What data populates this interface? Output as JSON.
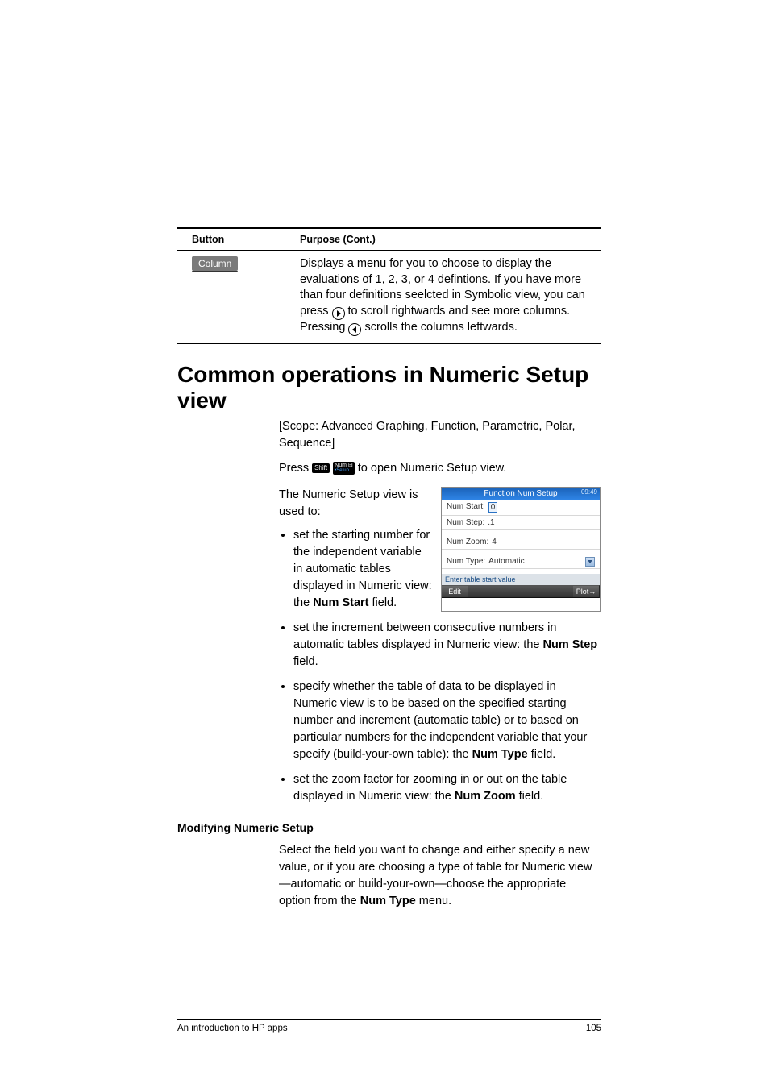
{
  "table": {
    "header_button": "Button",
    "header_purpose": "Purpose  (Cont.)",
    "column_btn": "Column",
    "purpose_l1": "Displays a menu for you to choose to display the evaluations of 1, 2, 3, or 4 defintions. If you have more than four definitions seelcted in Symbolic view, you can press ",
    "purpose_l2": " to scroll rightwards and see more columns. Pressing ",
    "purpose_l3": " scrolls the columns leftwards."
  },
  "section_title": "Common operations in Numeric Setup view",
  "scope": "[Scope: Advanced Graphing, Function, Parametric, Polar, Sequence]",
  "press_pre": "Press ",
  "key_shift": "Shift",
  "key_num_top": "Num",
  "key_num_sub": "•Setup",
  "press_post": " to open Numeric Setup view.",
  "used_to": "The Numeric Setup view is used to:",
  "bul1_a": "set the starting number for the independent variable in automatic tables displayed in Numeric view: the ",
  "bul1_b": "Num Start",
  "bul1_c": " field.",
  "bul2_a": "set the increment between consecutive numbers in automatic tables displayed in Numeric view: the ",
  "bul2_b": "Num Step",
  "bul2_c": " field.",
  "bul3_a": "specify whether the table of data to be displayed in Numeric view is to be based on the specified starting number and increment (automatic table) or to based on particular numbers for the independent variable that your specify (build-your-own table): the ",
  "bul3_b": "Num Type",
  "bul3_c": " field.",
  "bul4_a": "set the zoom factor for zooming in or out on the table displayed in Numeric view: the ",
  "bul4_b": "Num Zoom",
  "bul4_c": " field.",
  "subhead": "Modifying Numeric Setup",
  "subpara_a": "Select the field you want to change and either specify a new value, or if you are choosing a type of table for Numeric view—automatic or build-your-own—choose the appropriate option from the ",
  "subpara_b": "Num Type",
  "subpara_c": " menu.",
  "calc": {
    "title": "Function Num Setup",
    "clock": "09:49",
    "numstart_lbl": "Num Start:",
    "numstart_val": "0",
    "numstep_lbl": "Num Step:",
    "numstep_val": ".1",
    "numzoom_lbl": "Num Zoom:",
    "numzoom_val": "4",
    "numtype_lbl": "Num Type:",
    "numtype_val": "Automatic",
    "hint": "Enter table start value",
    "edit": "Edit",
    "plot": "Plot→"
  },
  "footer_left": "An introduction to HP apps",
  "footer_right": "105"
}
